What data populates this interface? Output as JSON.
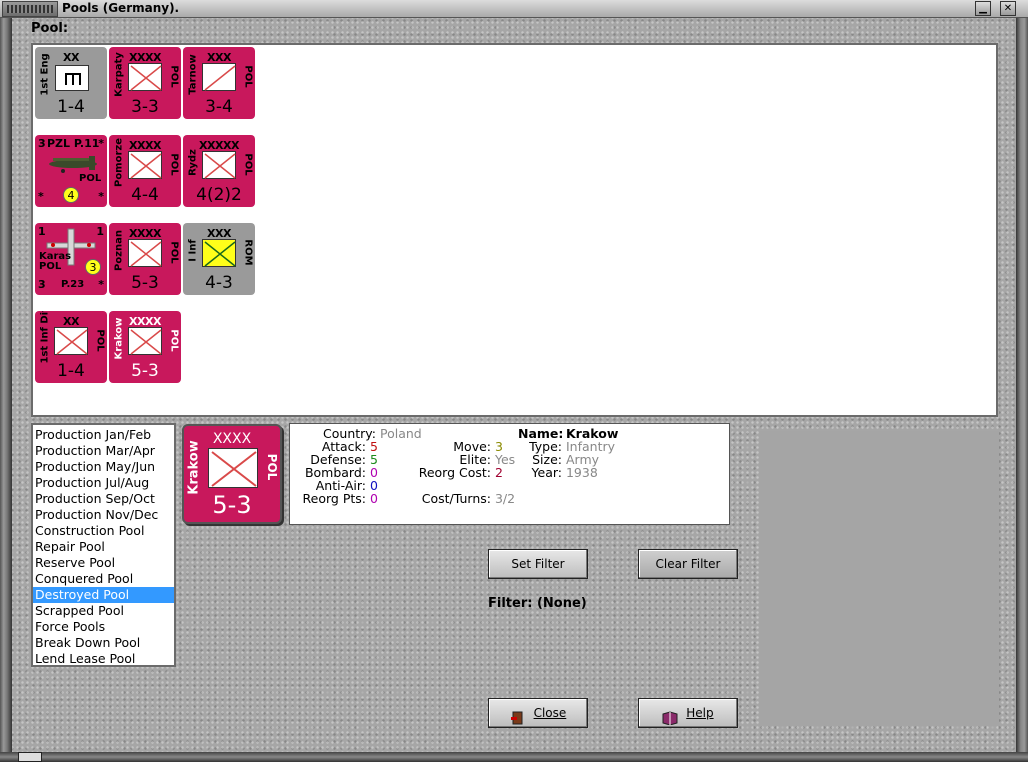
{
  "window": {
    "title": "Pools (Germany).",
    "pool_label": "Pool:"
  },
  "counters": [
    {
      "id": "eng",
      "size": "XX",
      "name": "1st Eng",
      "country": "",
      "strength": "1-4",
      "color": "grey",
      "symbol": "engineer"
    },
    {
      "id": "karpaty",
      "size": "XXXX",
      "name": "Karpaty",
      "country": "POL",
      "strength": "3-3",
      "color": "crimson",
      "symbol": "infantry"
    },
    {
      "id": "tarnow",
      "size": "XXX",
      "name": "Tarnow",
      "country": "POL",
      "strength": "3-4",
      "color": "crimson",
      "symbol": "cavalry"
    },
    {
      "id": "pomorze",
      "size": "XXXX",
      "name": "Pomorze",
      "country": "POL",
      "strength": "4-4",
      "color": "crimson",
      "symbol": "infantry"
    },
    {
      "id": "rydz",
      "size": "XXXXX",
      "name": "Rydz",
      "country": "POL",
      "strength": "4(2)2",
      "color": "crimson",
      "symbol": "infantry"
    },
    {
      "id": "poznan",
      "size": "XXXX",
      "name": "Poznan",
      "country": "POL",
      "strength": "5-3",
      "color": "crimson",
      "symbol": "infantry"
    },
    {
      "id": "iinf",
      "size": "XXX",
      "name": "I Inf",
      "country": "ROM",
      "strength": "4-3",
      "color": "grey",
      "symbol": "infantry-yellow"
    },
    {
      "id": "inf1",
      "size": "XX",
      "name": "1st Inf Div",
      "country": "POL",
      "strength": "1-4",
      "color": "crimson",
      "symbol": "infantry"
    },
    {
      "id": "krakow",
      "size": "XXXX",
      "name": "Krakow",
      "country": "POL",
      "strength": "5-3",
      "color": "crimson",
      "symbol": "infantry"
    }
  ],
  "air_counters": [
    {
      "id": "pzl11",
      "top_left": "3",
      "title": "PZL P.11",
      "top_right": "*",
      "country": "POL",
      "bottom_left": "*",
      "bottom_right": "*",
      "badge": "4"
    },
    {
      "id": "p23",
      "top_left": "1",
      "top_right": "1",
      "name": "Karas",
      "country": "POL",
      "bottom_left": "3",
      "subtitle": "P.23",
      "bottom_right": "*",
      "badge": "3"
    }
  ],
  "pool_list": {
    "items": [
      "Production Jan/Feb",
      "Production Mar/Apr",
      "Production May/Jun",
      "Production Jul/Aug",
      "Production Sep/Oct",
      "Production Nov/Dec",
      "Construction Pool",
      "Repair Pool",
      "Reserve Pool",
      "Conquered Pool",
      "Destroyed Pool",
      "Scrapped Pool",
      "Force Pools",
      "Break Down Pool",
      "Lend Lease Pool"
    ],
    "selected": "Destroyed Pool"
  },
  "selected_unit": {
    "size": "XXXX",
    "name": "Krakow",
    "country": "POL",
    "strength": "5-3"
  },
  "details": {
    "country_label": "Country:",
    "country_value": "Poland",
    "attack_label": "Attack:",
    "attack_value": "5",
    "defense_label": "Defense:",
    "defense_value": "5",
    "bombard_label": "Bombard:",
    "bombard_value": "0",
    "antiair_label": "Anti-Air:",
    "antiair_value": "0",
    "reorgpts_label": "Reorg Pts:",
    "reorgpts_value": "0",
    "move_label": "Move:",
    "move_value": "3",
    "elite_label": "Elite:",
    "elite_value": "Yes",
    "reorgcost_label": "Reorg Cost:",
    "reorgcost_value": "2",
    "costturns_label": "Cost/Turns:",
    "costturns_value": "3/2",
    "name_label": "Name:",
    "name_value": "Krakow",
    "type_label": "Type:",
    "type_value": "Infantry",
    "size_label": "Size:",
    "size_value": "Army",
    "year_label": "Year:",
    "year_value": "1938"
  },
  "buttons": {
    "set_filter": "Set Filter",
    "clear_filter": "Clear Filter",
    "close": "Close",
    "help": "Help"
  },
  "filter": {
    "text": "Filter: (None)"
  },
  "colors": {
    "counter_crimson": "#c8185c",
    "counter_grey": "#9a9a9a",
    "list_selected": "#3399ff"
  }
}
